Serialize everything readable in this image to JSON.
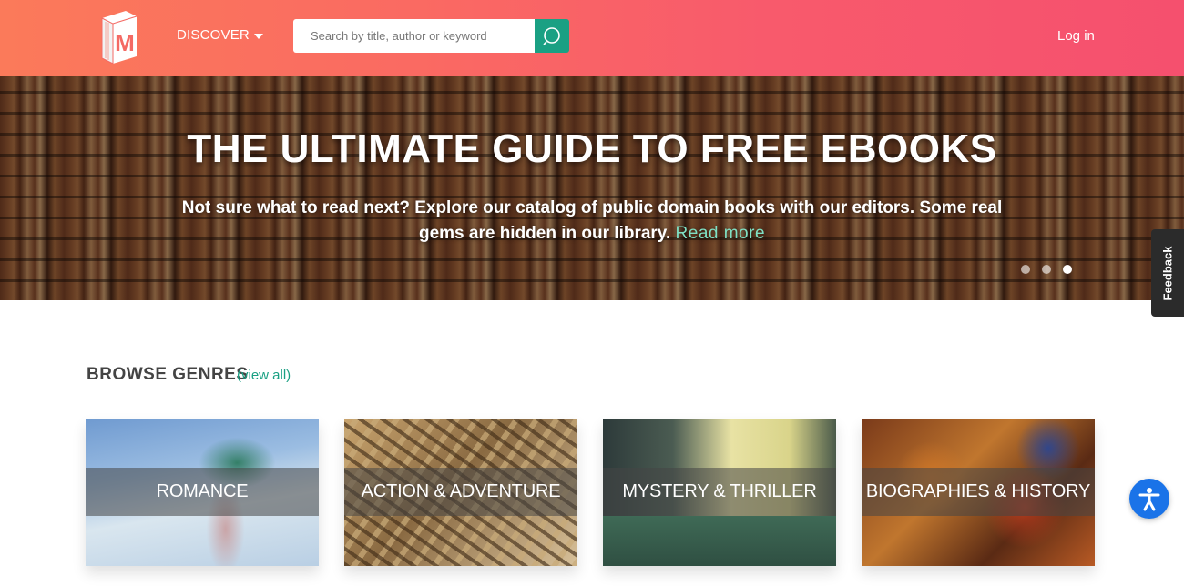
{
  "header": {
    "logo_letter": "M",
    "discover_label": "DISCOVER",
    "search": {
      "placeholder": "Search by title, author or keyword",
      "value": ""
    },
    "login_label": "Log in"
  },
  "hero": {
    "title": "THE ULTIMATE GUIDE TO FREE EBOOKS",
    "subtitle": "Not sure what to read next? Explore our catalog of public domain books with our editors. Some real gems are hidden in our library.",
    "read_more": "Read more",
    "slides_total": 3,
    "active_slide": 3
  },
  "feedback_label": "Feedback",
  "genres_section": {
    "title": "BROWSE GENRES",
    "view_all": "(view all)",
    "items": [
      {
        "label": "ROMANCE"
      },
      {
        "label": "ACTION & ADVENTURE"
      },
      {
        "label": "MYSTERY & THRILLER"
      },
      {
        "label": "BIOGRAPHIES & HISTORY"
      }
    ]
  },
  "colors": {
    "header_gradient_start": "#fb7a5a",
    "header_gradient_end": "#f5506e",
    "accent_teal": "#1aa083",
    "accessibility_blue": "#1a73e8"
  },
  "icons": {
    "logo": "book-m-icon",
    "discover": "caret-down-icon",
    "search": "search-icon",
    "accessibility": "accessibility-icon"
  }
}
